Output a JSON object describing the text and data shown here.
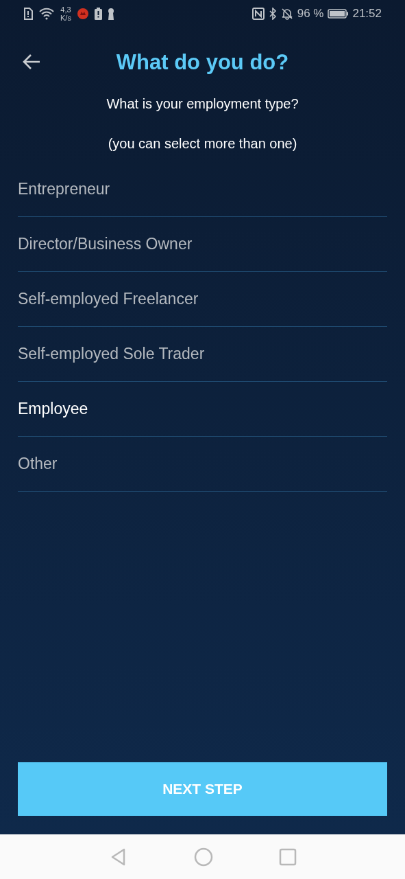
{
  "status_bar": {
    "speed_value": "4,3",
    "speed_unit": "K/s",
    "battery_percent": "96 %",
    "time": "21:52"
  },
  "header": {
    "title": "What do you do?"
  },
  "question": "What is your employment type?",
  "hint": "(you can select more than one)",
  "options": [
    {
      "label": "Entrepreneur",
      "selected": false
    },
    {
      "label": "Director/Business Owner",
      "selected": false
    },
    {
      "label": "Self-employed Freelancer",
      "selected": false
    },
    {
      "label": "Self-employed Sole Trader",
      "selected": false
    },
    {
      "label": "Employee",
      "selected": true
    },
    {
      "label": "Other",
      "selected": false
    }
  ],
  "next_button": "NEXT STEP"
}
